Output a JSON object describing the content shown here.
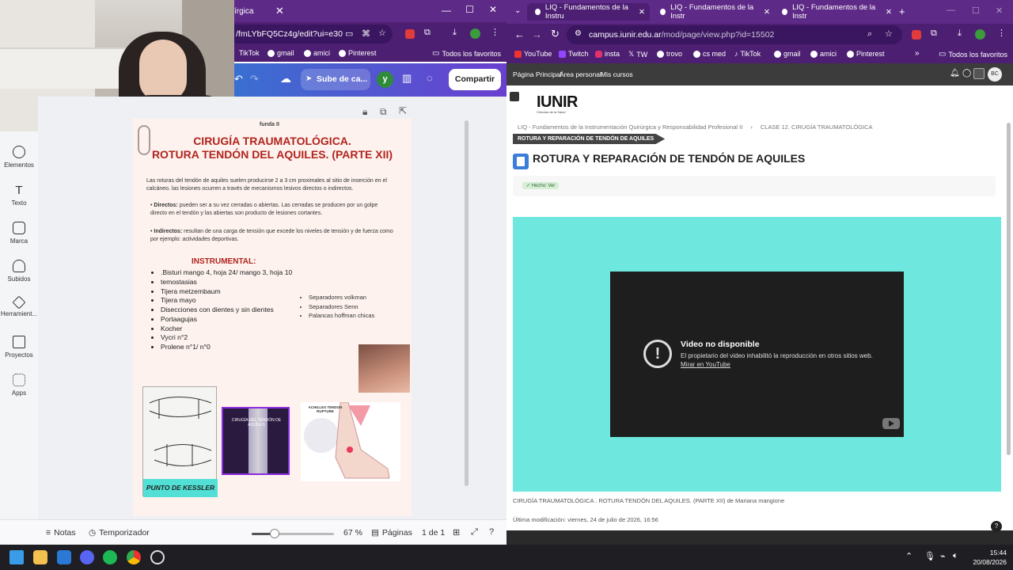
{
  "left_window": {
    "tab_title_partial": "írgica",
    "address": "/fmLYbFQ5Cz4g/edit?ui=e30",
    "bookmarks": [
      "TikTok",
      "gmail",
      "amici",
      "Pinterest"
    ],
    "all_bookmarks": "Todos los favoritos",
    "canva_toolbar": {
      "upload_label": "Sube de ca...",
      "avatar_letter": "y",
      "share_label": "Compartir"
    },
    "sidebar": [
      {
        "label": "Elementos",
        "icon": "elements-icon"
      },
      {
        "label": "Texto",
        "icon": "text-icon"
      },
      {
        "label": "Marca",
        "icon": "brand-icon"
      },
      {
        "label": "Subidos",
        "icon": "uploads-icon"
      },
      {
        "label": "Herramient...",
        "icon": "tools-icon"
      },
      {
        "label": "Proyectos",
        "icon": "folder-icon"
      },
      {
        "label": "Apps",
        "icon": "apps-icon"
      }
    ],
    "page": {
      "tag": "funda II",
      "title_line1": "CIRUGÍA TRAUMATOLÓGICA.",
      "title_line2": "ROTURA TENDÓN DEL AQUILES. (PARTE XII)",
      "intro": "Las roturas del tendón de aquiles suelen producirse 2 a 3 cm proximales al sitio de inserción en el calcáneo. las lesiones ocurren a través de mecanismos lesivos directos o indirectos.",
      "directos_label": "Directos:",
      "directos_text": "pueden ser a su vez cerradas o abiertas. Las cerradas se producen por un golpe directo en el tendón y las abiertas son producto de lesiones cortantes.",
      "indirectos_label": "Indirectos:",
      "indirectos_text": "resultan de una carga de tensión que excede los niveles de tensión y de fuerza como por ejemplo: actividades deportivas.",
      "instrumental_title": "INSTRUMENTAL:",
      "instrumental_list": [
        ".Bisturi mango 4, hoja 24/ mango 3, hoja 10",
        "temostasias",
        "Tijera metzembaum",
        "Tijera mayo",
        "Disecciones con dientes y sin dientes",
        "Portaagujas",
        "Kocher",
        "Vycri n°2",
        "Prolene n°1/ n°0"
      ],
      "side_list": [
        "Separadores volkman",
        "Separadores Senn",
        "Palancas hoffman chicas"
      ],
      "kessler_label": "PUNTO DE KESSLER",
      "image_caption_1": "CIRUGÍA DEL TENDÓN DE AQUILES",
      "image_caption_2": "ACHILLES TENDON RUPTURE"
    },
    "bottom_bar": {
      "notes": "Notas",
      "timer": "Temporizador",
      "zoom_value": 0.28,
      "zoom": "67 %",
      "pages_label": "Páginas",
      "page_count": "1 de 1"
    }
  },
  "right_window": {
    "tabs": [
      {
        "title": "LIQ - Fundamentos de la Instru",
        "active": true
      },
      {
        "title": "LIQ - Fundamentos de la Instr",
        "active": false
      },
      {
        "title": "LIQ - Fundamentos de la Instr",
        "active": false
      }
    ],
    "address_domain": "campus.iunir.edu.ar",
    "address_path": "/mod/page/view.php?id=15502",
    "bookmarks": [
      "YouTube",
      "Twitch",
      "insta",
      "TW",
      "trovo",
      "cs med",
      "TikTok",
      "gmail",
      "amici",
      "Pinterest"
    ],
    "all_bookmarks": "Todos los favoritos",
    "nav": [
      "Página Principal",
      "Área personal",
      "Mis cursos"
    ],
    "user_initials": "BC",
    "logo": "IUNIR",
    "logo_sub": "Ciencias de la Salud",
    "breadcrumb_course": "LIQ - Fundamentos de la Instrumentación Quirúrgica y Responsabilidad Profesional II",
    "breadcrumb_section": "CLASE 12. CIRUGÍA TRAUMATOLÓGICA",
    "breadcrumb_current": "ROTURA Y REPARACIÓN DE TENDÓN DE AQUILES",
    "page_title": "ROTURA Y REPARACIÓN DE TENDÓN DE AQUILES",
    "done_badge": "Hecho: Ver",
    "video": {
      "title": "Video no disponible",
      "message": "El propietario del video inhabilitó la reproducción en otros sitios web.",
      "link": "Mirar en YouTube",
      "bg_color": "#6ee8de"
    },
    "caption": "CIRUGÍA TRAUMATOLÓGICA . ROTURA TENDÓN DEL AQUILES. (PARTE XII) de Mariana mangione",
    "last_modified": "Última modificación: viernes, 24 de julio de 2026, 16:56"
  },
  "taskbar": {
    "time": "15:44",
    "date": "20/08/2026"
  }
}
